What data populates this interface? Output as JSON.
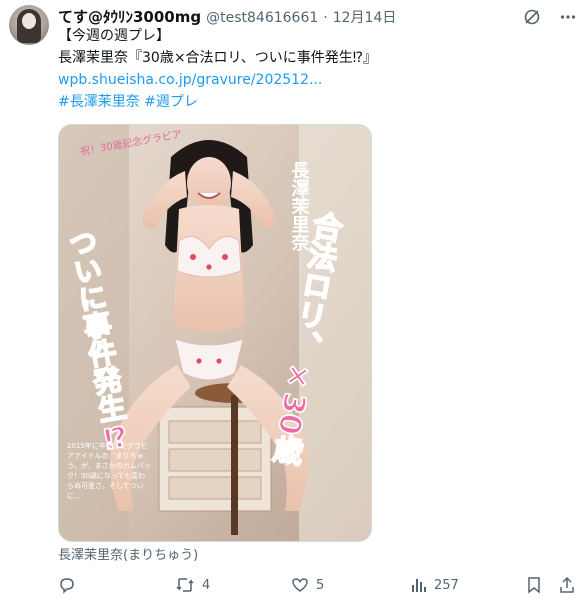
{
  "author": {
    "display_name": "てす@ﾀｳﾘﾝ3000mg",
    "handle": "@test84616661",
    "separator": "·",
    "date": "12月14日"
  },
  "tweet": {
    "lines": [
      "【今週の週プレ】",
      "長澤茉里奈『30歳×合法ロリ、ついに事件発生⁉』",
      "wpb.shueisha.co.jp/gravure/202512...",
      "#長澤茉里奈 #週プレ"
    ]
  },
  "media": {
    "badge": "祝！30歳記念グラビア",
    "name_vertical": "長澤茉里奈",
    "headline_1": "合法ロリ、×30歳",
    "headline_2": "ついに事件発生⁉",
    "caption_small": "2015年に卒業したグラビアアイドルの〝まりちゅう〟が、まさかのカムバック！30歳になっても変わらぬ可愛さ。そしてついに…",
    "alt_text": "長澤茉里奈(まりちゅう)"
  },
  "actions": {
    "reply_count": "",
    "retweet_count": "4",
    "like_count": "5",
    "views_count": "257"
  },
  "colors": {
    "accent": "#1d9bf0",
    "secondary_text": "#536471",
    "pink_title": "#f06aa6"
  },
  "icons": [
    "grok-icon",
    "more-icon",
    "reply-icon",
    "retweet-icon",
    "like-icon",
    "views-icon",
    "bookmark-icon",
    "share-icon"
  ]
}
